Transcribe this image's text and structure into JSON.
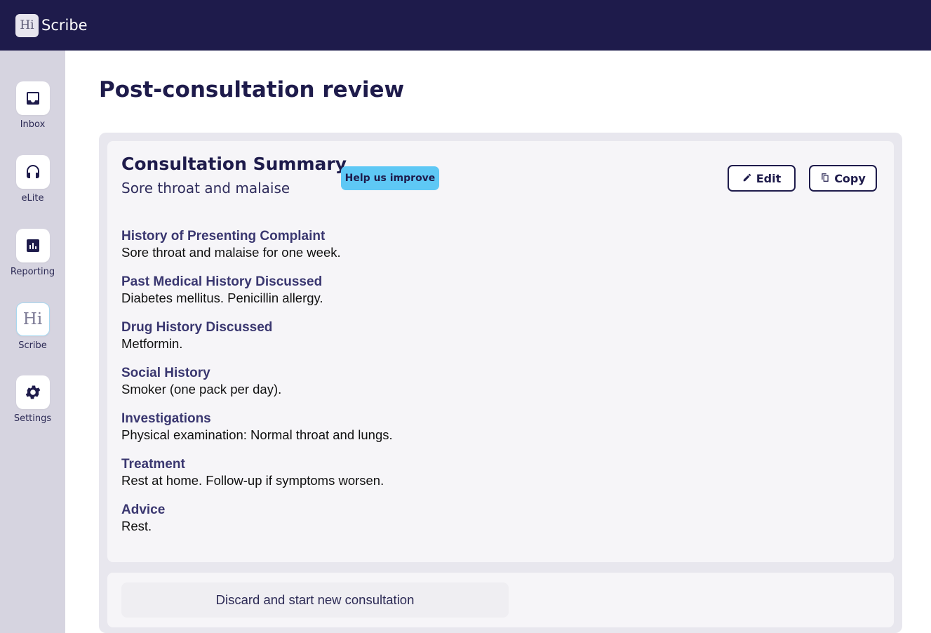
{
  "header": {
    "logo_mark": "Hi",
    "app_name": "Scribe"
  },
  "sidebar": {
    "items": [
      {
        "label": "Inbox",
        "icon": "inbox-icon"
      },
      {
        "label": "eLite",
        "icon": "headphones-icon"
      },
      {
        "label": "Reporting",
        "icon": "bar-chart-icon"
      },
      {
        "label": "Scribe",
        "icon": "hi-logo-icon",
        "mark": "Hi"
      },
      {
        "label": "Settings",
        "icon": "gear-icon"
      }
    ]
  },
  "page": {
    "title": "Post-consultation review"
  },
  "summary": {
    "title": "Consultation Summary",
    "subtitle": "Sore throat and malaise",
    "help_label": "Help us improve",
    "edit_label": "Edit",
    "copy_label": "Copy",
    "sections": [
      {
        "heading": "History of Presenting Complaint",
        "body": "Sore throat and malaise for one week."
      },
      {
        "heading": "Past Medical History Discussed",
        "body": "Diabetes mellitus. Penicillin allergy."
      },
      {
        "heading": "Drug History Discussed",
        "body": "Metformin."
      },
      {
        "heading": "Social History",
        "body": "Smoker (one pack per day)."
      },
      {
        "heading": "Investigations",
        "body": "Physical examination: Normal throat and lungs."
      },
      {
        "heading": "Treatment",
        "body": "Rest at home. Follow-up if symptoms worsen."
      },
      {
        "heading": "Advice",
        "body": "Rest."
      }
    ]
  },
  "footer": {
    "discard_label": "Discard and start new consultation"
  },
  "colors": {
    "navy": "#1e1b4b",
    "sidebar_bg": "#d6d4e0",
    "accent_cyan": "#5ec8f5"
  }
}
